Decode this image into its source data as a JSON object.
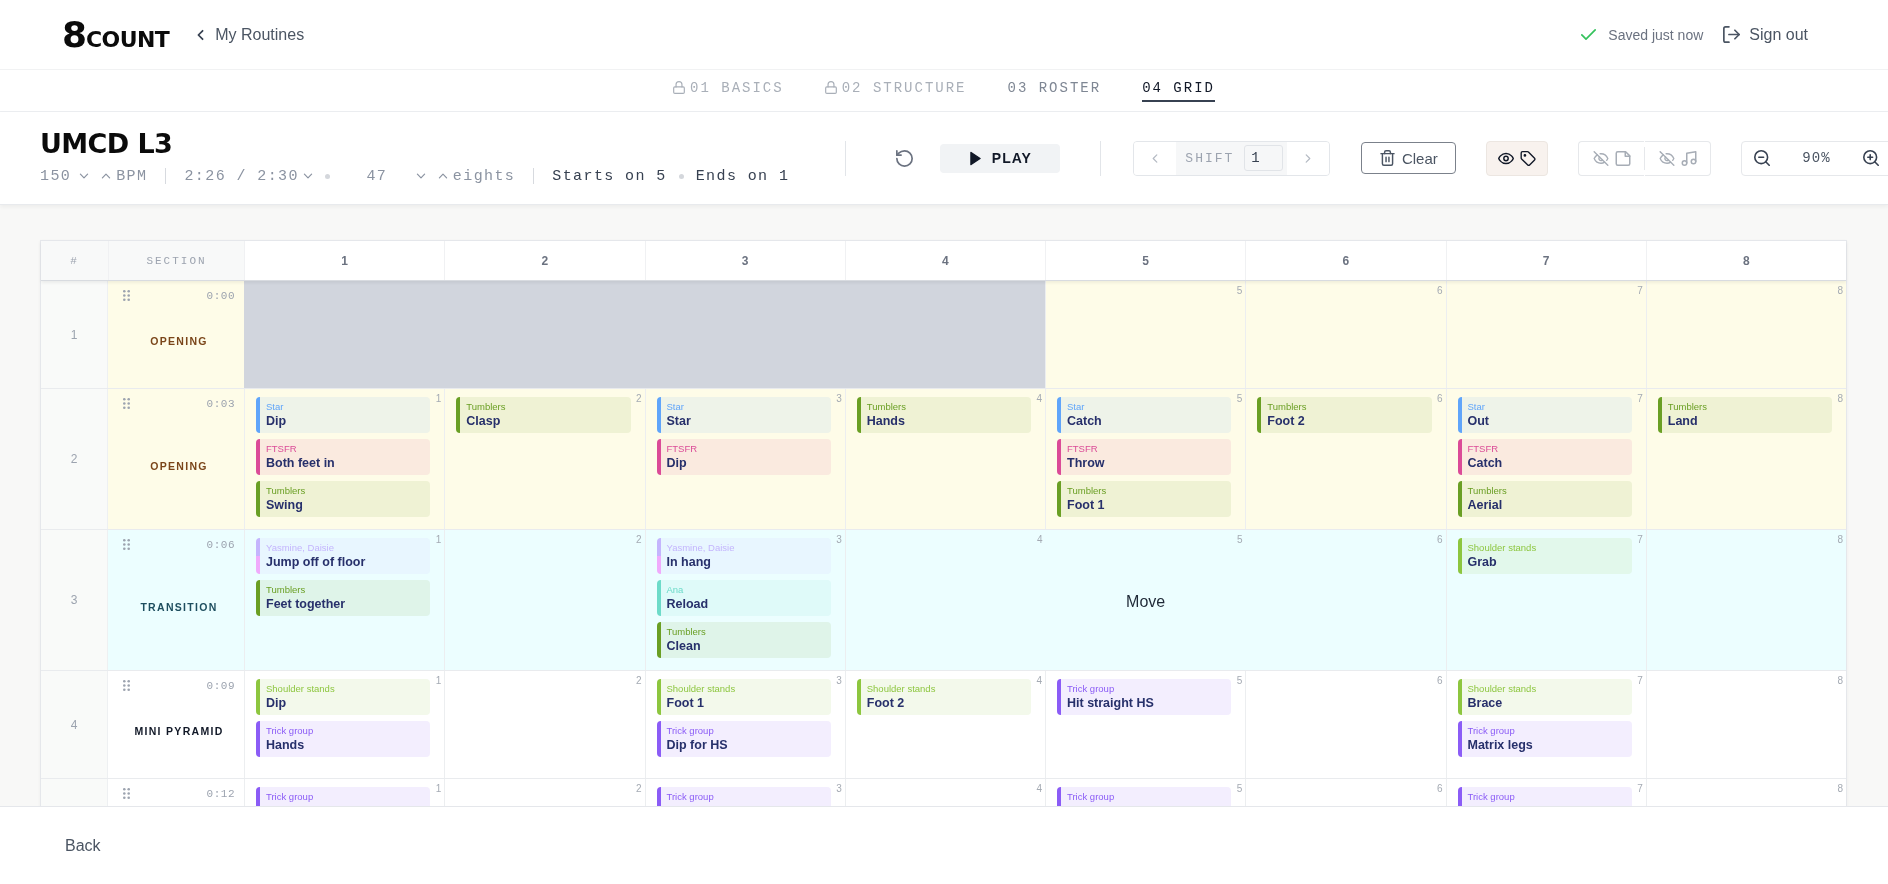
{
  "header": {
    "logo": {
      "mark": "8",
      "word": "COUNT"
    },
    "back_link": "My Routines",
    "save_status": "Saved just now",
    "sign_out": "Sign out"
  },
  "tabs": [
    {
      "label": "01 BASICS",
      "locked": true,
      "selected": false
    },
    {
      "label": "02 STRUCTURE",
      "locked": true,
      "selected": false
    },
    {
      "label": "03 ROSTER",
      "locked": false,
      "selected": false
    },
    {
      "label": "04 GRID",
      "locked": false,
      "selected": true
    }
  ],
  "routine": {
    "title": "UMCD L3",
    "bpm": "150",
    "bpm_unit": "BPM",
    "duration": "2:26 / 2:30",
    "eights": "47",
    "eights_unit": "eights",
    "starts": "Starts on 5",
    "ends": "Ends on 1"
  },
  "toolbar": {
    "play": "PLAY",
    "shift_label": "SHIFT",
    "shift_value": "1",
    "clear": "Clear",
    "toggle_groups": [
      {
        "toggles": [
          {
            "kind": "tags",
            "on": true
          }
        ]
      },
      {
        "toggles": [
          {
            "kind": "notes",
            "on": false
          },
          {
            "kind": "music",
            "on": false
          }
        ]
      }
    ],
    "zoom": "90%"
  },
  "grid": {
    "columns": [
      "#",
      "SECTION",
      "1",
      "2",
      "3",
      "4",
      "5",
      "6",
      "7",
      "8"
    ],
    "rows": [
      {
        "number": "1",
        "time": "0:00",
        "section": "OPENING",
        "color": "#fefce8",
        "beats": [
          {
            "kind": "blocked"
          },
          {
            "kind": "blocked"
          },
          {
            "kind": "blocked"
          },
          {
            "kind": "blocked"
          },
          {
            "kind": "cell",
            "number": "5"
          },
          {
            "kind": "cell",
            "number": "6"
          },
          {
            "kind": "cell",
            "number": "7"
          },
          {
            "kind": "cell",
            "number": "8"
          }
        ]
      },
      {
        "number": "2",
        "time": "0:03",
        "section": "OPENING",
        "color": "#fefce8",
        "beats": [
          {
            "kind": "cell",
            "number": "1",
            "cards": [
              {
                "group": "Star",
                "move": "Dip",
                "stripes": [
                  {
                    "color": "#60a5fa"
                  }
                ]
              },
              {
                "group": "FTSFR",
                "move": "Both feet in",
                "stripes": [
                  {
                    "color": "#db4b97"
                  }
                ]
              },
              {
                "group": "Tumblers",
                "move": "Swing",
                "stripes": [
                  {
                    "color": "#6a9f24"
                  }
                ]
              }
            ]
          },
          {
            "kind": "cell",
            "number": "2",
            "cards": [
              {
                "group": "Tumblers",
                "move": "Clasp",
                "stripes": [
                  {
                    "color": "#6a9f24"
                  }
                ]
              }
            ]
          },
          {
            "kind": "cell",
            "number": "3",
            "cards": [
              {
                "group": "Star",
                "move": "Star",
                "stripes": [
                  {
                    "color": "#60a5fa"
                  }
                ]
              },
              {
                "group": "FTSFR",
                "move": "Dip",
                "stripes": [
                  {
                    "color": "#db4b97"
                  }
                ]
              }
            ]
          },
          {
            "kind": "cell",
            "number": "4",
            "cards": [
              {
                "group": "Tumblers",
                "move": "Hands",
                "stripes": [
                  {
                    "color": "#6a9f24"
                  }
                ]
              }
            ]
          },
          {
            "kind": "cell",
            "number": "5",
            "cards": [
              {
                "group": "Star",
                "move": "Catch",
                "stripes": [
                  {
                    "color": "#60a5fa"
                  }
                ]
              },
              {
                "group": "FTSFR",
                "move": "Throw",
                "stripes": [
                  {
                    "color": "#db4b97"
                  }
                ]
              },
              {
                "group": "Tumblers",
                "move": "Foot 1",
                "stripes": [
                  {
                    "color": "#6a9f24"
                  }
                ]
              }
            ]
          },
          {
            "kind": "cell",
            "number": "6",
            "cards": [
              {
                "group": "Tumblers",
                "move": "Foot 2",
                "stripes": [
                  {
                    "color": "#6a9f24"
                  }
                ]
              }
            ]
          },
          {
            "kind": "cell",
            "number": "7",
            "cards": [
              {
                "group": "Star",
                "move": "Out",
                "stripes": [
                  {
                    "color": "#60a5fa"
                  }
                ]
              },
              {
                "group": "FTSFR",
                "move": "Catch",
                "stripes": [
                  {
                    "color": "#db4b97"
                  }
                ]
              },
              {
                "group": "Tumblers",
                "move": "Aerial",
                "stripes": [
                  {
                    "color": "#6a9f24"
                  }
                ]
              }
            ]
          },
          {
            "kind": "cell",
            "number": "8",
            "cards": [
              {
                "group": "Tumblers",
                "move": "Land",
                "stripes": [
                  {
                    "color": "#6a9f24"
                  }
                ]
              }
            ]
          }
        ]
      },
      {
        "number": "3",
        "time": "0:06",
        "section": "TRANSITION",
        "color": "#ecfeff",
        "beats": [
          {
            "kind": "cell",
            "number": "1",
            "cards": [
              {
                "group": "Yasmine, Daisie",
                "move": "Jump off of floor",
                "stripes": [
                  {
                    "color": "#c4b5fd"
                  },
                  {
                    "color": "#f0abfc"
                  }
                ]
              },
              {
                "group": "Tumblers",
                "move": "Feet together",
                "stripes": [
                  {
                    "color": "#6a9f24"
                  }
                ]
              }
            ]
          },
          {
            "kind": "cell",
            "number": "2"
          },
          {
            "kind": "cell",
            "number": "3",
            "cards": [
              {
                "group": "Yasmine, Daisie",
                "move": "In hang",
                "stripes": [
                  {
                    "color": "#c4b5fd"
                  },
                  {
                    "color": "#f0abfc"
                  }
                ]
              },
              {
                "group": "Ana",
                "move": "Reload",
                "stripes": [
                  {
                    "color": "#6ddbc9"
                  }
                ]
              },
              {
                "group": "Tumblers",
                "move": "Clean",
                "stripes": [
                  {
                    "color": "#6a9f24"
                  }
                ]
              }
            ]
          },
          {
            "kind": "merged",
            "numbers": [
              "4",
              "5",
              "6"
            ],
            "label": "Move"
          },
          {
            "kind": "cell",
            "number": "7",
            "cards": [
              {
                "group": "Shoulder stands",
                "move": "Grab",
                "stripes": [
                  {
                    "color": "#8dc63f"
                  }
                ]
              }
            ]
          },
          {
            "kind": "cell",
            "number": "8"
          }
        ]
      },
      {
        "number": "4",
        "time": "0:09",
        "section": "MINI PYRAMID",
        "color": "#ffffff",
        "beats": [
          {
            "kind": "cell",
            "number": "1",
            "cards": [
              {
                "group": "Shoulder stands",
                "move": "Dip",
                "stripes": [
                  {
                    "color": "#8dc63f"
                  }
                ]
              },
              {
                "group": "Trick group",
                "move": "Hands",
                "stripes": [
                  {
                    "color": "#8b5cf6"
                  }
                ]
              }
            ]
          },
          {
            "kind": "cell",
            "number": "2"
          },
          {
            "kind": "cell",
            "number": "3",
            "cards": [
              {
                "group": "Shoulder stands",
                "move": "Foot 1",
                "stripes": [
                  {
                    "color": "#8dc63f"
                  }
                ]
              },
              {
                "group": "Trick group",
                "move": "Dip for HS",
                "stripes": [
                  {
                    "color": "#8b5cf6"
                  }
                ]
              }
            ]
          },
          {
            "kind": "cell",
            "number": "4",
            "cards": [
              {
                "group": "Shoulder stands",
                "move": "Foot 2",
                "stripes": [
                  {
                    "color": "#8dc63f"
                  }
                ]
              }
            ]
          },
          {
            "kind": "cell",
            "number": "5",
            "cards": [
              {
                "group": "Trick group",
                "move": "Hit straight HS",
                "stripes": [
                  {
                    "color": "#8b5cf6"
                  }
                ]
              }
            ]
          },
          {
            "kind": "cell",
            "number": "6"
          },
          {
            "kind": "cell",
            "number": "7",
            "cards": [
              {
                "group": "Shoulder stands",
                "move": "Brace",
                "stripes": [
                  {
                    "color": "#8dc63f"
                  }
                ]
              },
              {
                "group": "Trick group",
                "move": "Matrix legs",
                "stripes": [
                  {
                    "color": "#8b5cf6"
                  }
                ]
              }
            ]
          },
          {
            "kind": "cell",
            "number": "8"
          }
        ]
      },
      {
        "time": "0:12",
        "color": "#ffffff",
        "beats": [
          {
            "kind": "cell",
            "number": "1",
            "cards": [
              {
                "group": "Trick group",
                "stripes": [
                  {
                    "color": "#8b5cf6"
                  }
                ]
              }
            ]
          },
          {
            "kind": "cell",
            "number": "2"
          },
          {
            "kind": "cell",
            "number": "3",
            "cards": [
              {
                "group": "Trick group",
                "stripes": [
                  {
                    "color": "#8b5cf6"
                  }
                ]
              }
            ]
          },
          {
            "kind": "cell",
            "number": "4"
          },
          {
            "kind": "cell",
            "number": "5",
            "cards": [
              {
                "group": "Trick group",
                "stripes": [
                  {
                    "color": "#8b5cf6"
                  }
                ]
              }
            ]
          },
          {
            "kind": "cell",
            "number": "6"
          },
          {
            "kind": "cell",
            "number": "7",
            "cards": [
              {
                "group": "Trick group",
                "stripes": [
                  {
                    "color": "#8b5cf6"
                  }
                ]
              }
            ]
          },
          {
            "kind": "cell",
            "number": "8"
          }
        ]
      }
    ]
  },
  "footer": {
    "back": "Back"
  }
}
